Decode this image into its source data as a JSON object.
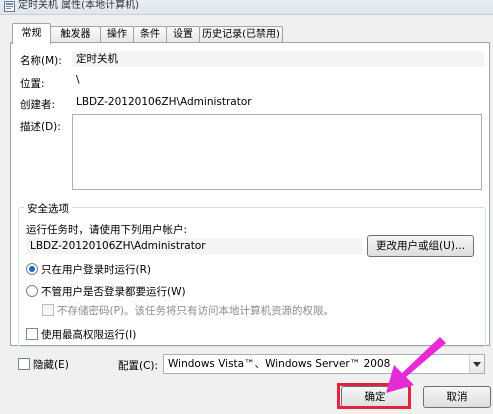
{
  "window": {
    "title": "定时关机 属性(本地计算机)"
  },
  "tabs": [
    {
      "label": "常规",
      "active": true
    },
    {
      "label": "触发器",
      "active": false
    },
    {
      "label": "操作",
      "active": false
    },
    {
      "label": "条件",
      "active": false
    },
    {
      "label": "设置",
      "active": false
    },
    {
      "label": "历史记录(已禁用)",
      "active": false
    }
  ],
  "general": {
    "name_label": "名称(M):",
    "name_value": "定时关机",
    "location_label": "位置:",
    "location_value": "\\",
    "author_label": "创建者:",
    "author_value": "LBDZ-20120106ZH\\Administrator",
    "description_label": "描述(D):",
    "description_value": ""
  },
  "security": {
    "group_title": "安全选项",
    "run_as_label": "运行任务时，请使用下列用户帐户:",
    "run_as_value": "LBDZ-20120106ZH\\Administrator",
    "change_user_button": "更改用户或组(U)...",
    "radio_logged_on": "只在用户登录时运行(R)",
    "radio_logged_on_checked": true,
    "radio_whether_logged_on": "不管用户是否登录都要运行(W)",
    "radio_whether_logged_on_checked": false,
    "no_store_password": "不存储密码(P)。该任务将只有访问本地计算机资源的权限。",
    "highest_privileges": "使用最高权限运行(I)"
  },
  "footer": {
    "hidden_label": "隐藏(E)",
    "configure_label": "配置(C):",
    "configure_value": "Windows Vista™、Windows Server™ 2008",
    "ok_button": "确定",
    "cancel_button": "取消"
  },
  "colors": {
    "highlight_box": "#e0233e",
    "arrow": "#e62ad6"
  }
}
